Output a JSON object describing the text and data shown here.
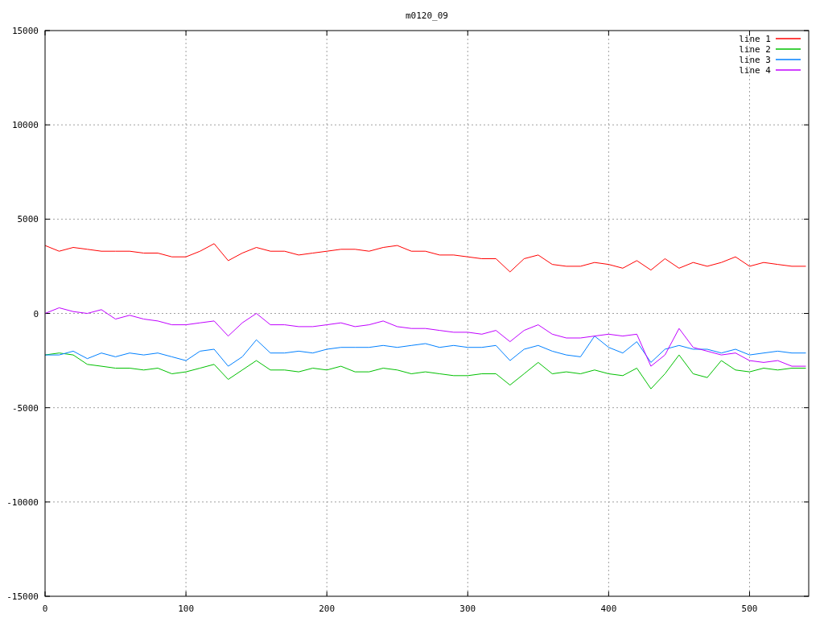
{
  "chart_data": {
    "type": "line",
    "title": "m0120_09",
    "x": [
      0,
      10,
      20,
      30,
      40,
      50,
      60,
      70,
      80,
      90,
      100,
      110,
      120,
      130,
      140,
      150,
      160,
      170,
      180,
      190,
      200,
      210,
      220,
      230,
      240,
      250,
      260,
      270,
      280,
      290,
      300,
      310,
      320,
      330,
      340,
      350,
      360,
      370,
      380,
      390,
      400,
      410,
      420,
      430,
      440,
      450,
      460,
      470,
      480,
      490,
      500,
      510,
      520,
      530,
      540
    ],
    "series": [
      {
        "name": "line 1",
        "color": "#ff0000",
        "values": [
          3600,
          3300,
          3500,
          3400,
          3300,
          3300,
          3300,
          3200,
          3200,
          3000,
          3000,
          3300,
          3700,
          2800,
          3200,
          3500,
          3300,
          3300,
          3100,
          3200,
          3300,
          3400,
          3400,
          3300,
          3500,
          3600,
          3300,
          3300,
          3100,
          3100,
          3000,
          2900,
          2900,
          2200,
          2900,
          3100,
          2600,
          2500,
          2500,
          2700,
          2600,
          2400,
          2800,
          2300,
          2900,
          2400,
          2700,
          2500,
          2700,
          3000,
          2500,
          2700,
          2600,
          2500,
          2500
        ]
      },
      {
        "name": "line 2",
        "color": "#00c000",
        "values": [
          -2200,
          -2100,
          -2200,
          -2700,
          -2800,
          -2900,
          -2900,
          -3000,
          -2900,
          -3200,
          -3100,
          -2900,
          -2700,
          -3500,
          -3000,
          -2500,
          -3000,
          -3000,
          -3100,
          -2900,
          -3000,
          -2800,
          -3100,
          -3100,
          -2900,
          -3000,
          -3200,
          -3100,
          -3200,
          -3300,
          -3300,
          -3200,
          -3200,
          -3800,
          -3200,
          -2600,
          -3200,
          -3100,
          -3200,
          -3000,
          -3200,
          -3300,
          -2900,
          -4000,
          -3200,
          -2200,
          -3200,
          -3400,
          -2500,
          -3000,
          -3100,
          -2900,
          -3000,
          -2900,
          -2900
        ]
      },
      {
        "name": "line 3",
        "color": "#0080ff",
        "values": [
          -2200,
          -2200,
          -2000,
          -2400,
          -2100,
          -2300,
          -2100,
          -2200,
          -2100,
          -2300,
          -2500,
          -2000,
          -1900,
          -2800,
          -2300,
          -1400,
          -2100,
          -2100,
          -2000,
          -2100,
          -1900,
          -1800,
          -1800,
          -1800,
          -1700,
          -1800,
          -1700,
          -1600,
          -1800,
          -1700,
          -1800,
          -1800,
          -1700,
          -2500,
          -1900,
          -1700,
          -2000,
          -2200,
          -2300,
          -1200,
          -1800,
          -2100,
          -1500,
          -2600,
          -1900,
          -1700,
          -1900,
          -1900,
          -2100,
          -1900,
          -2200,
          -2100,
          -2000,
          -2100,
          -2100
        ]
      },
      {
        "name": "line 4",
        "color": "#c000ff",
        "values": [
          0,
          300,
          100,
          0,
          200,
          -300,
          -100,
          -300,
          -400,
          -600,
          -600,
          -500,
          -400,
          -1200,
          -500,
          0,
          -600,
          -600,
          -700,
          -700,
          -600,
          -500,
          -700,
          -600,
          -400,
          -700,
          -800,
          -800,
          -900,
          -1000,
          -1000,
          -1100,
          -900,
          -1500,
          -900,
          -600,
          -1100,
          -1300,
          -1300,
          -1200,
          -1100,
          -1200,
          -1100,
          -2800,
          -2200,
          -800,
          -1800,
          -2000,
          -2200,
          -2100,
          -2500,
          -2600,
          -2500,
          -2800,
          -2800
        ]
      }
    ],
    "xlim": [
      0,
      542
    ],
    "ylim": [
      -15000,
      15000
    ],
    "xticks": [
      0,
      100,
      200,
      300,
      400,
      500
    ],
    "yticks": [
      -15000,
      -10000,
      -5000,
      0,
      5000,
      10000,
      15000
    ],
    "grid": true,
    "legend": true
  }
}
